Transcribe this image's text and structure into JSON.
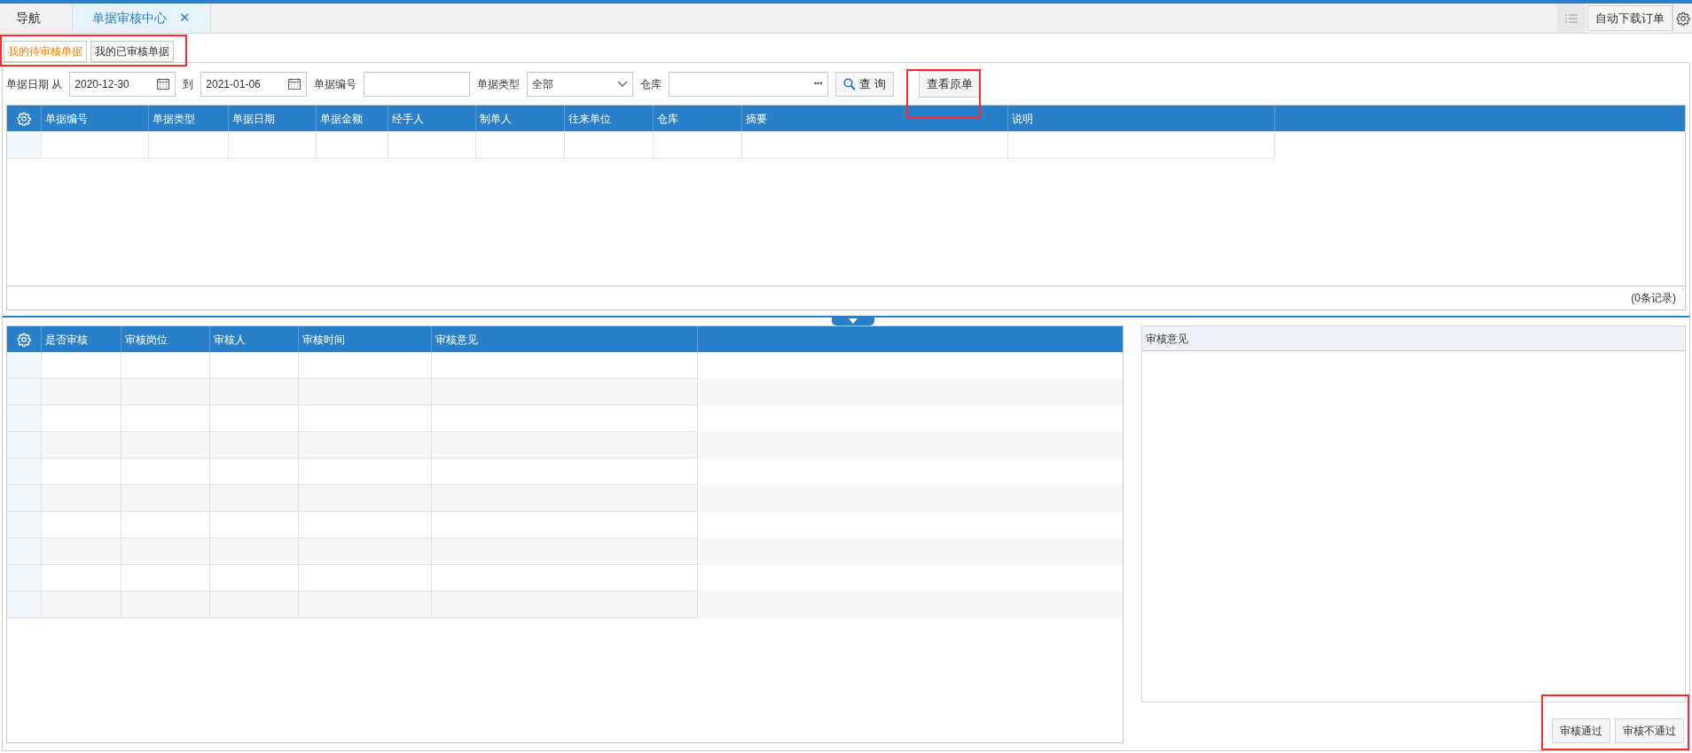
{
  "tabs": [
    {
      "label": "导航",
      "selected": false
    },
    {
      "label": "单据审核中心",
      "selected": true,
      "close_icon": "✕"
    }
  ],
  "toolbar": {
    "button": "自动下载订单"
  },
  "sub_tabs": [
    {
      "label": "我的待审核单据",
      "selected": true
    },
    {
      "label": "我的已审核单据",
      "selected": false
    }
  ],
  "filters": {
    "date_label": "单据日期 从",
    "date_from": "2020-12-30",
    "to_label": "到",
    "date_to": "2021-01-06",
    "number_label": "单据编号",
    "type_label": "单据类型",
    "type_value": "全部",
    "warehouse_label": "仓库",
    "warehouse_more": "•••",
    "query_button": "查 询",
    "view_button": "查看原单"
  },
  "documents_table": {
    "columns": [
      "单据编号",
      "单据类型",
      "单据日期",
      "单据金额",
      "经手人",
      "制单人",
      "往来单位",
      "仓库",
      "摘要",
      "说明"
    ],
    "record_count": "(0条记录)"
  },
  "audit_table": {
    "columns": [
      "是否审核",
      "审核岗位",
      "审核人",
      "审核时间",
      "审核意见"
    ]
  },
  "comment_panel": {
    "title": "审核意见"
  },
  "actions": [
    "审核通过",
    "审核不通过"
  ]
}
